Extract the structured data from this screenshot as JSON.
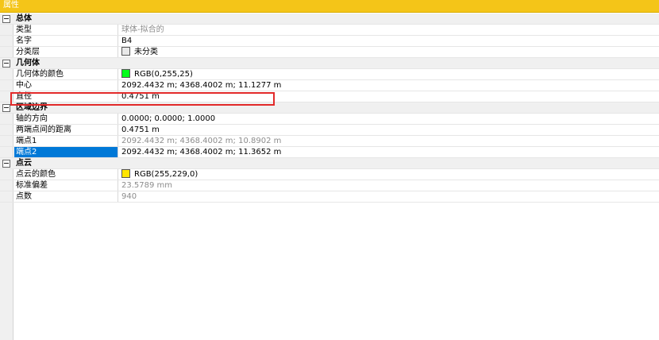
{
  "window": {
    "title": "属性"
  },
  "sections": {
    "general": {
      "label": "总体",
      "type_label": "类型",
      "type_value": "球体-拟合的",
      "name_label": "名字",
      "name_value": "B4",
      "layer_label": "分类层",
      "layer_value": "未分类"
    },
    "geometry": {
      "label": "几何体",
      "color_label": "几何体的颜色",
      "color_value": "RGB(0,255,25)",
      "color_hex": "#00ff19",
      "center_label": "中心",
      "center_value": "2092.4432 m; 4368.4002 m; 11.1277 m",
      "diameter_label": "直径",
      "diameter_value": "0.4751 m"
    },
    "bounds": {
      "label": "区域边界",
      "axis_label": "轴的方向",
      "axis_value": "0.0000; 0.0000; 1.0000",
      "distance_label": "两端点间的距离",
      "distance_value": "0.4751 m",
      "end1_label": "端点1",
      "end1_value": "2092.4432 m; 4368.4002 m; 10.8902 m",
      "end2_label": "端点2",
      "end2_value": "2092.4432 m; 4368.4002 m; 11.3652 m"
    },
    "pointcloud": {
      "label": "点云",
      "color_label": "点云的颜色",
      "color_value": "RGB(255,229,0)",
      "color_hex": "#ffe500",
      "stddev_label": "标准偏差",
      "stddev_value": "23.5789 mm",
      "count_label": "点数",
      "count_value": "940"
    }
  },
  "colors": {
    "title_bar": "#f4c518",
    "selection": "#0078d7",
    "highlight_box": "#e22a2a"
  }
}
